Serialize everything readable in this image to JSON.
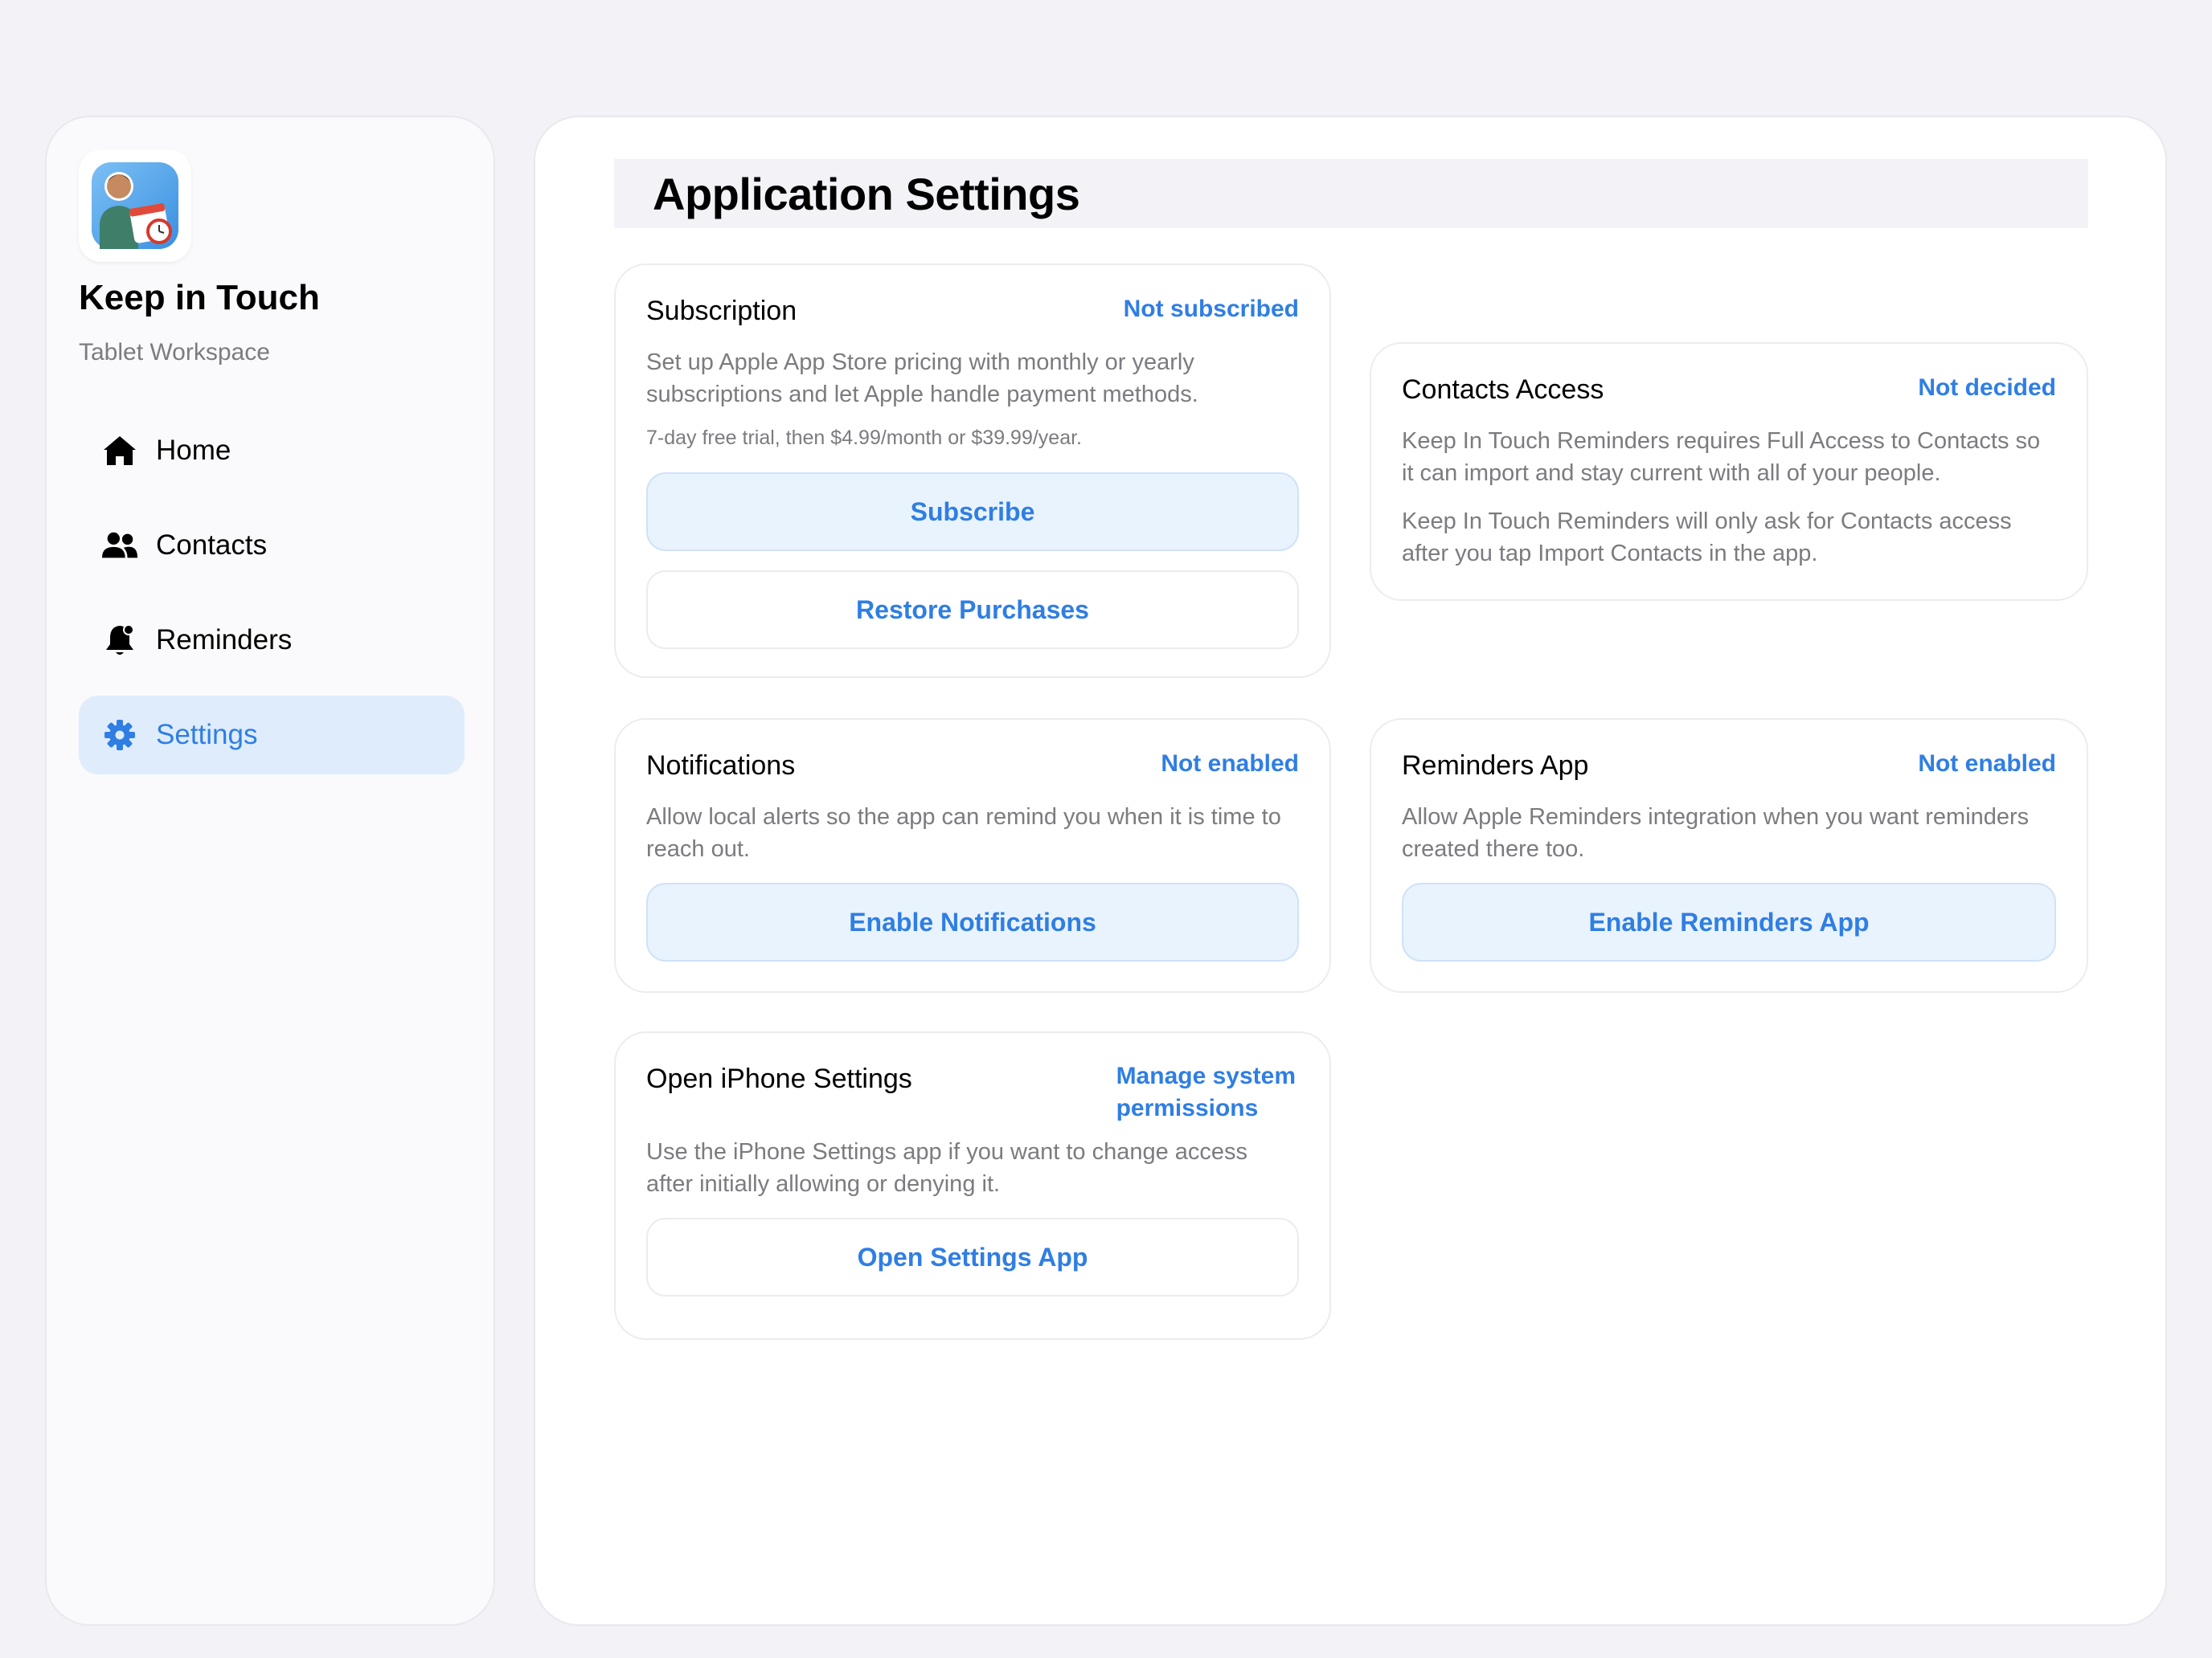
{
  "sidebar": {
    "app_name": "Keep in Touch",
    "app_subtitle": "Tablet Workspace",
    "items": [
      {
        "label": "Home",
        "icon": "house-icon"
      },
      {
        "label": "Contacts",
        "icon": "people-icon"
      },
      {
        "label": "Reminders",
        "icon": "bell-icon"
      },
      {
        "label": "Settings",
        "icon": "gear-icon",
        "active": true
      }
    ]
  },
  "main": {
    "title": "Application Settings"
  },
  "cards": {
    "subscription": {
      "title": "Subscription",
      "status": "Not subscribed",
      "description": "Set up Apple App Store pricing with monthly or yearly subscriptions and let Apple handle payment methods.",
      "note": "7-day free trial, then $4.99/month or $39.99/year.",
      "primary_button": "Subscribe",
      "secondary_button": "Restore Purchases"
    },
    "contacts": {
      "title": "Contacts Access",
      "status": "Not decided",
      "description": "Keep In Touch Reminders requires Full Access to Contacts so it can import and stay current with all of your people.",
      "description2": "Keep In Touch Reminders will only ask for Contacts access after you tap Import Contacts in the app."
    },
    "notifications": {
      "title": "Notifications",
      "status": "Not enabled",
      "description": "Allow local alerts so the app can remind you when it is time to reach out.",
      "button": "Enable Notifications"
    },
    "reminders_app": {
      "title": "Reminders App",
      "status": "Not enabled",
      "description": "Allow Apple Reminders integration when you want reminders created there too.",
      "button": "Enable Reminders App"
    },
    "iphone_settings": {
      "title": "Open iPhone Settings",
      "status_line1": "Manage system",
      "status_line2": "permissions",
      "description": "Use the iPhone Settings app if you want to change access after initially allowing or denying it.",
      "button": "Open Settings App"
    }
  },
  "colors": {
    "accent": "#2f7ee3",
    "background": "#f2f2f7",
    "active_nav": "#dfecfb",
    "secondary_text": "#7b7b80"
  }
}
